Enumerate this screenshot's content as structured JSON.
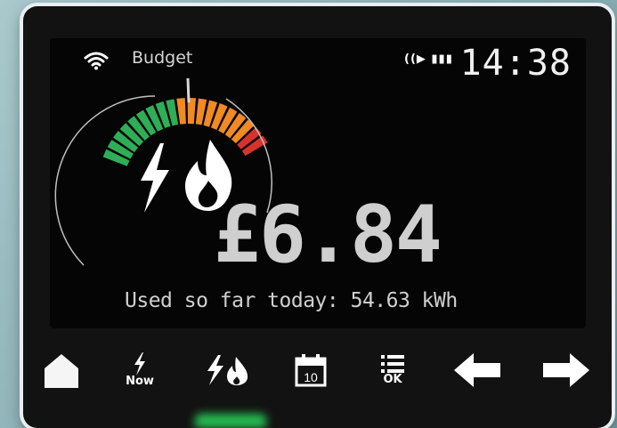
{
  "screen": {
    "budget_label": "Budget",
    "time": "14:38",
    "signal_text": "((▶ ▮▮▮",
    "cost": "£6.84",
    "usage_text": "Used so far today: 54.63 kWh",
    "icons": [
      "wifi-icon",
      "electricity-icon",
      "gas-flame-icon"
    ],
    "gauge_levels": {
      "green_segments": 9,
      "orange_segments": 8,
      "red_segments": 2
    },
    "colors": {
      "green": "#2fae57",
      "orange": "#f08a24",
      "red": "#d8322f"
    }
  },
  "buttons": {
    "home": {
      "icon": "home-icon"
    },
    "now": {
      "icon": "lightning-icon",
      "label": "Now"
    },
    "dual_fuel": {
      "icon": "dual-fuel-icon"
    },
    "calendar": {
      "icon": "calendar-icon",
      "label": "10"
    },
    "menu_ok": {
      "icon": "menu-list-icon",
      "label": "OK"
    },
    "back": {
      "icon": "arrow-left-icon"
    },
    "forward": {
      "icon": "arrow-right-icon"
    }
  }
}
